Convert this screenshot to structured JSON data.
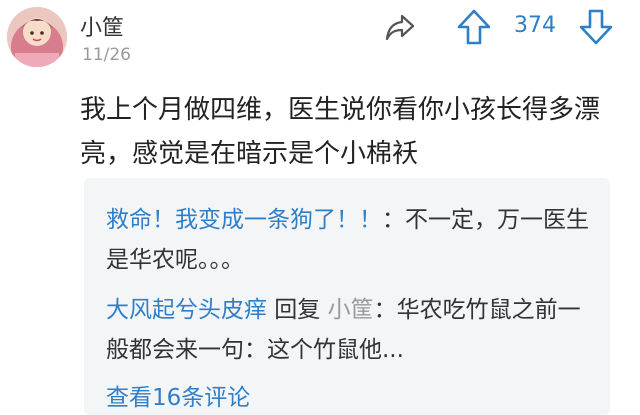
{
  "comment": {
    "username": "小筐",
    "date": "11/26",
    "vote_count": "374",
    "content": "我上个月做四维，医生说你看你小孩长得多漂亮，感觉是在暗示是个小棉袄"
  },
  "replies": [
    {
      "author": "救命！我变成一条狗了！！",
      "sep": "：",
      "text": "不一定，万一医生是华农呢。。。"
    },
    {
      "author": "大风起兮头皮痒",
      "reply_word": " 回复 ",
      "target": "小筐",
      "sep": "：",
      "text": "华农吃竹鼠之前一般都会来一句：这个竹鼠他..."
    }
  ],
  "view_more": "查看16条评论",
  "icons": {
    "share": "share-icon",
    "upvote": "upvote-arrow-icon",
    "downvote": "downvote-arrow-icon"
  },
  "colors": {
    "link": "#2f7fc8",
    "muted": "#9a9a9a",
    "reply_bg": "#f4f5f7"
  }
}
